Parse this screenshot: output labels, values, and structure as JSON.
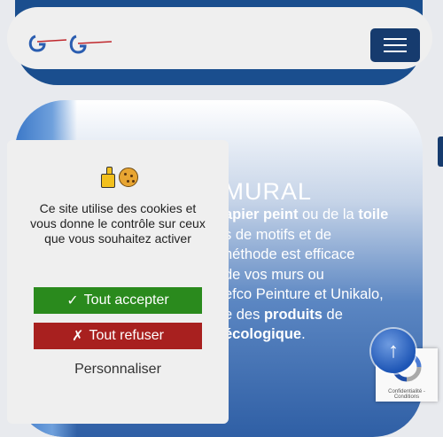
{
  "header": {
    "logo_name": "brand-logo",
    "menu_icon": "hamburger-icon"
  },
  "hero": {
    "title": "T MURAL",
    "lines": [
      {
        "parts": [
          {
            "t": "apier peint",
            "b": true
          },
          {
            "t": " ou de la ",
            "b": false
          },
          {
            "t": "toile",
            "b": true
          }
        ]
      },
      {
        "parts": [
          {
            "t": "s de motifs et de",
            "b": false
          }
        ]
      },
      {
        "parts": [
          {
            "t": "néthode est efficace",
            "b": false
          }
        ]
      },
      {
        "parts": [
          {
            "t": "de vos murs ou",
            "b": false
          }
        ]
      },
      {
        "parts": [
          {
            "t": "efco Peinture et Unikalo,",
            "b": false
          }
        ]
      },
      {
        "parts": [
          {
            "t": "e des ",
            "b": false
          },
          {
            "t": "produits",
            "b": true
          },
          {
            "t": " de",
            "b": false
          }
        ]
      },
      {
        "parts": [
          {
            "t": "écologique",
            "b": true
          },
          {
            "t": ".",
            "b": false
          }
        ]
      }
    ]
  },
  "cookie": {
    "icons": [
      "hand-pointing-icon",
      "cookie-icon"
    ],
    "message": "Ce site utilise des cookies et vous donne le contrôle sur ceux que vous souhaitez activer",
    "accept_label": "Tout accepter",
    "accept_icon": "✓",
    "refuse_label": "Tout refuser",
    "refuse_icon": "✗",
    "customize_label": "Personnaliser"
  },
  "scroll_top": {
    "icon": "arrow-up-icon",
    "glyph": "↑"
  },
  "recaptcha": {
    "text": "Confidentialité - Conditions"
  },
  "colors": {
    "navy": "#163b6e",
    "accept": "#2a8a1d",
    "refuse": "#a8201f"
  }
}
